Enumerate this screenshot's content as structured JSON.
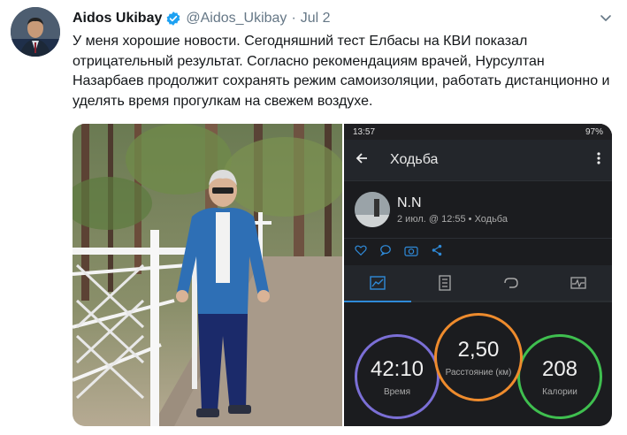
{
  "author": {
    "name": "Aidos Ukibay",
    "handle": "@Aidos_Ukibay",
    "separator": "·",
    "date": "Jul 2"
  },
  "tweet": {
    "text": "У меня хорошие новости. Сегодняшний тест Елбасы на КВИ показал отрицательный результат. Согласно рекомендациям врачей, Нурсултан Назарбаев продолжит сохранять режим самоизоляции, работать дистанционно и уделять время прогулкам на свежем воздухе."
  },
  "phone": {
    "status_time": "13:57",
    "status_battery": "97%",
    "app_title": "Ходьба",
    "user_name": "N.N",
    "activity_meta": "2 июл. @ 12:55 • Ходьба",
    "stats": [
      {
        "value": "42:10",
        "label": "Время",
        "color": "#7b6fd6"
      },
      {
        "value": "2,50",
        "label": "Расстояние (км)",
        "color": "#ee8b2d"
      },
      {
        "value": "208",
        "label": "Калории",
        "color": "#3fbf4f"
      }
    ]
  },
  "colors": {
    "verified": "#1da1f2",
    "accent": "#2f8ad8"
  }
}
